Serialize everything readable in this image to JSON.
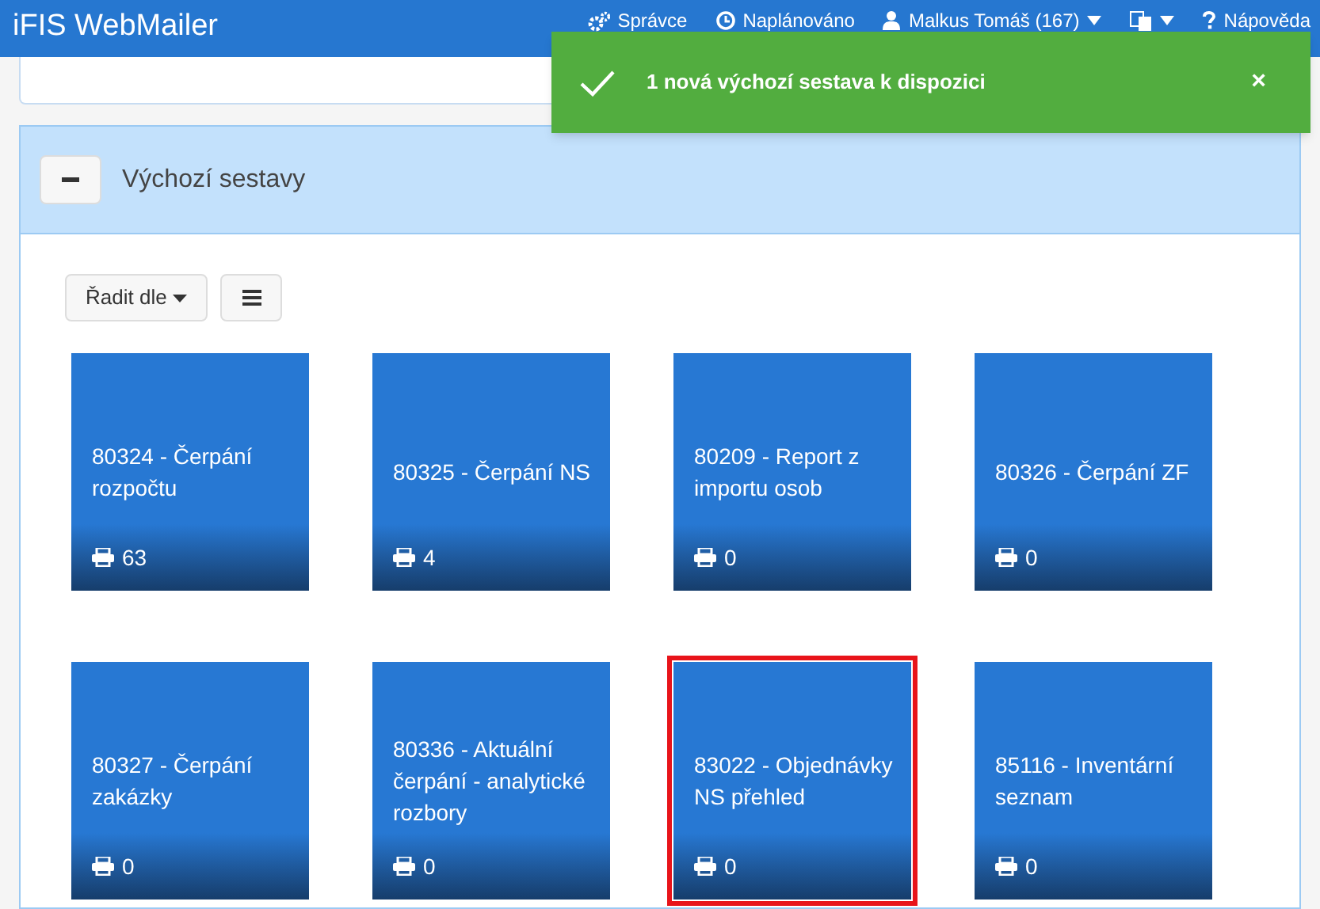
{
  "navbar": {
    "brand": "iFIS WebMailer",
    "items": [
      {
        "kind": "admin",
        "label": "Správce"
      },
      {
        "kind": "scheduled",
        "label": "Naplánováno"
      },
      {
        "kind": "user",
        "label": "Malkus Tomáš (167)"
      },
      {
        "kind": "language"
      },
      {
        "kind": "help",
        "label": "Nápověda"
      }
    ]
  },
  "toast": {
    "message": "1 nová výchozí sestava k dispozici",
    "close": "×"
  },
  "panel": {
    "title": "Výchozí sestavy",
    "expanded": true,
    "sort_button": "Řadit dle",
    "tiles": [
      {
        "title": "80324 - Čerpání rozpočtu",
        "count": "63",
        "selected": false
      },
      {
        "title": "80325 - Čerpání NS",
        "count": "4",
        "selected": false
      },
      {
        "title": "80209 - Report z importu osob",
        "count": "0",
        "selected": false
      },
      {
        "title": "80326 - Čerpání ZF",
        "count": "0",
        "selected": false
      },
      {
        "title": "80327 - Čerpání zakázky",
        "count": "0",
        "selected": false
      },
      {
        "title": "80336 - Aktuální čerpání - analytické rozbory",
        "count": "0",
        "selected": false
      },
      {
        "title": "83022 - Objednávky NS přehled",
        "count": "0",
        "selected": true
      },
      {
        "title": "85116 - Inventární seznam",
        "count": "0",
        "selected": false
      }
    ]
  }
}
